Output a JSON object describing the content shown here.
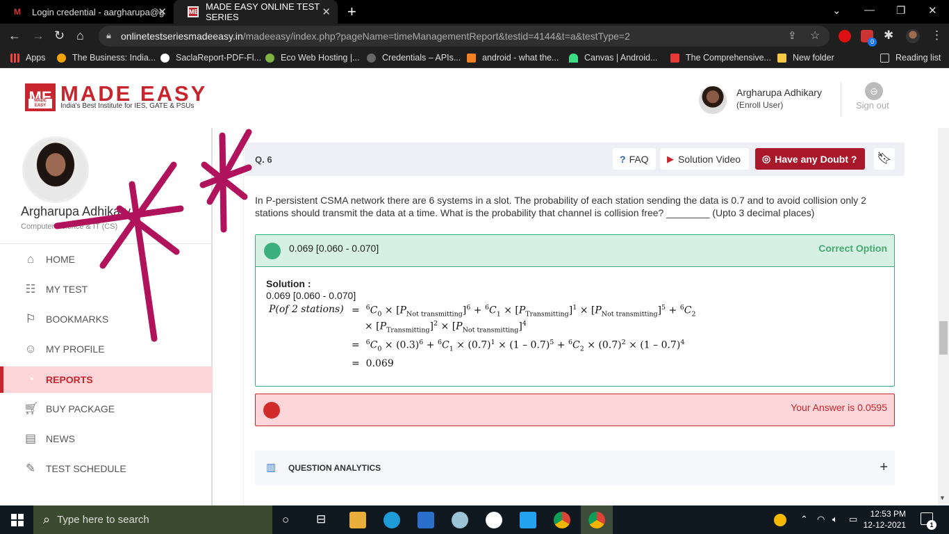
{
  "browser": {
    "tabs": [
      {
        "label": "Login credential - aargharupa@g"
      },
      {
        "label": "MADE EASY ONLINE TEST SERIES"
      }
    ],
    "url_domain": "onlinetestseriesmadeeasy.in",
    "url_path": "/madeeasy/index.php?pageName=timeManagementReport&testid=4144&t=a&testType=2",
    "bookmarks": [
      "Apps",
      "The Business: India...",
      "SaclaReport-PDF-Fl...",
      "Eco Web Hosting |...",
      "Credentials – APIs...",
      "android - what the...",
      "Canvas  |  Android...",
      "The Comprehensive...",
      "New folder"
    ],
    "reading_list": "Reading list",
    "extension_badge": "0"
  },
  "header": {
    "logo_mark": "ME",
    "logo_mark_sub": "MADE EASY",
    "brand": "MADE EASY",
    "tagline": "India's Best Institute for IES, GATE & PSUs",
    "user_name": "Argharupa Adhikary",
    "user_role": "(Enroll User)",
    "signout": "Sign out"
  },
  "sidebar": {
    "name": "Argharupa Adhikary",
    "branch": "Computer Science & IT (CS)",
    "menu": [
      {
        "label": "HOME",
        "icon": "home-icon"
      },
      {
        "label": "MY TEST",
        "icon": "test-icon"
      },
      {
        "label": "BOOKMARKS",
        "icon": "bookmark-icon"
      },
      {
        "label": "MY PROFILE",
        "icon": "profile-icon"
      },
      {
        "label": "REPORTS",
        "icon": "reports-icon",
        "active": true
      },
      {
        "label": "BUY PACKAGE",
        "icon": "cart-icon"
      },
      {
        "label": "NEWS",
        "icon": "news-icon"
      },
      {
        "label": "TEST SCHEDULE",
        "icon": "schedule-icon"
      }
    ]
  },
  "question": {
    "number": "Q. 6",
    "faq": "FAQ",
    "solution_video": "Solution Video",
    "doubt": "Have any Doubt ?",
    "text": "In P-persistent CSMA network there are 6 systems in a slot. The probability of each station sending the data is 0.7 and to avoid collision only 2 stations should transmit the data at a time. What is the probability that channel is collision free? ________ (Upto 3 decimal places)",
    "correct_answer": "0.069 [0.060 - 0.070]",
    "correct_label": "Correct Option",
    "solution_title": "Solution :",
    "solution_value": "0.069 [0.060 - 0.070]",
    "eq_lhs": "P(of 2 stations)",
    "eq_result": "0.069",
    "your_answer": "Your Answer is 0.0595",
    "analytics": "QUESTION ANALYTICS"
  },
  "taskbar": {
    "search_placeholder": "Type here to search",
    "time": "12:53 PM",
    "date": "12-12-2021",
    "notifications": "1"
  },
  "colors": {
    "brand_red": "#c8262e",
    "correct_green": "#3cb07c",
    "annotation_magenta": "#b0135c"
  }
}
